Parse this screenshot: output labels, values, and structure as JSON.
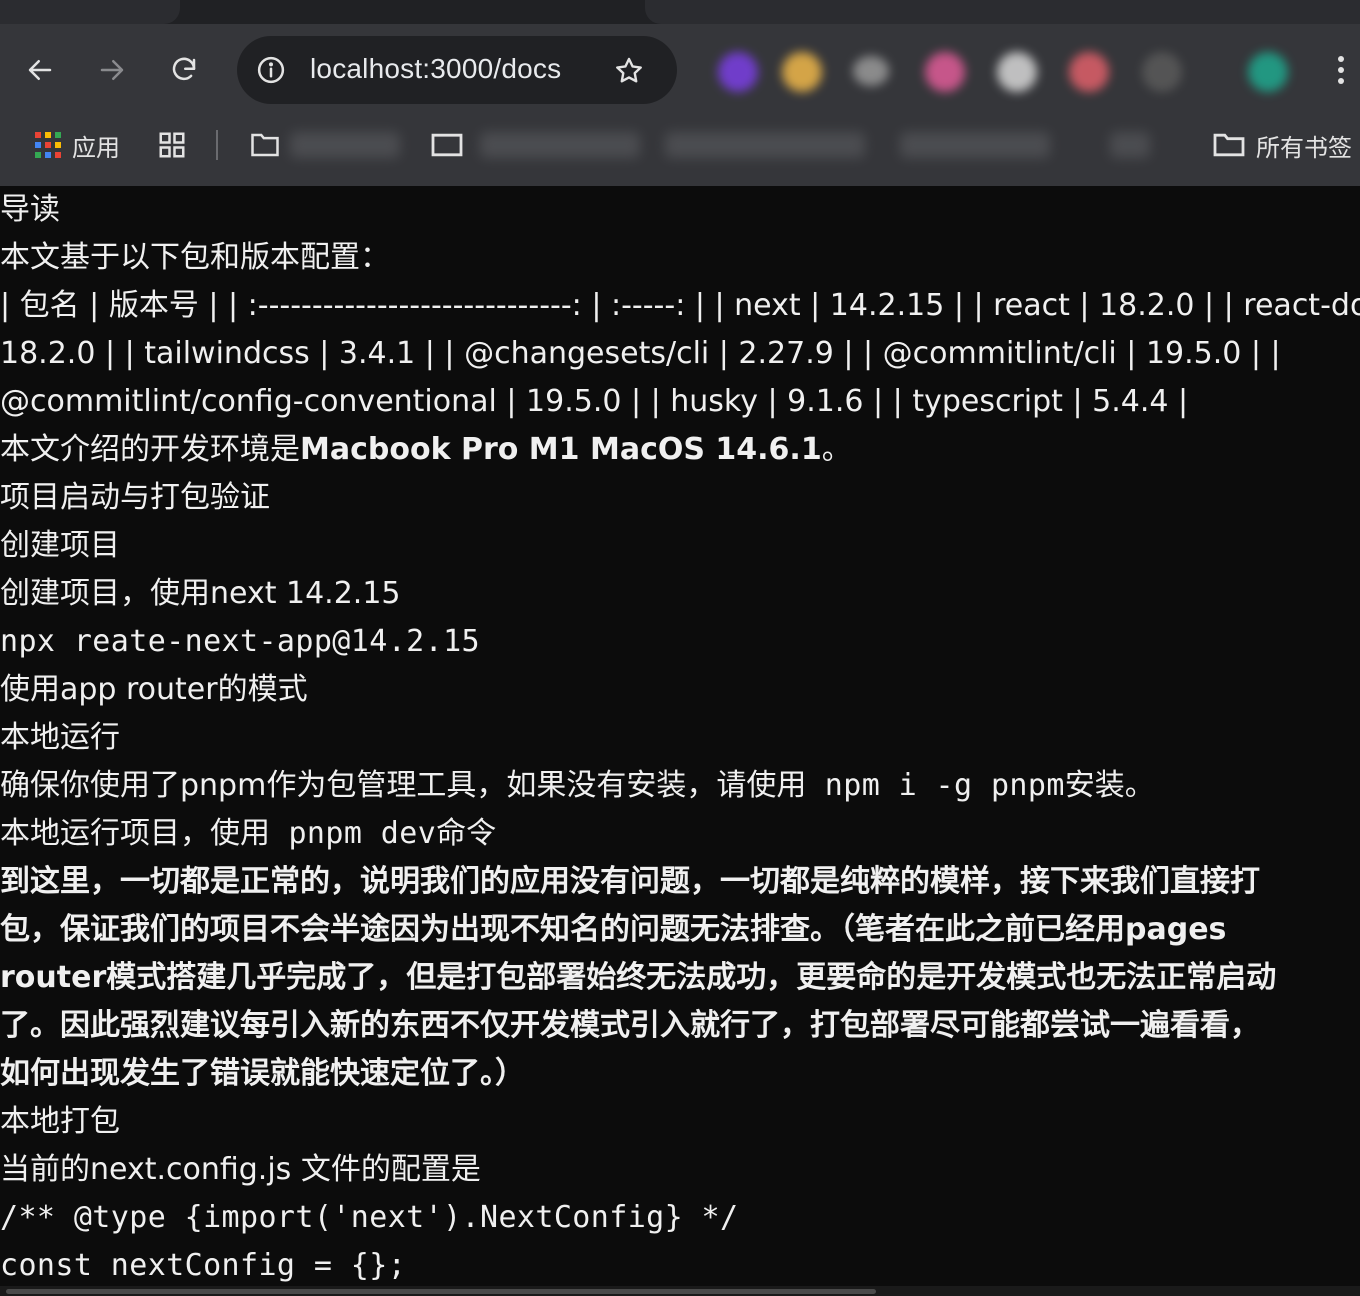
{
  "browser": {
    "url": "localhost:3000/docs",
    "bookmarks": {
      "apps_label": "应用",
      "all_bookmarks_label": "所有书签"
    },
    "extension_icon_colors": [
      "#7b3fe4",
      "#f0b84a",
      "#9a9a9a",
      "#e05c98",
      "#d8d8d8",
      "#e0606a",
      "#5a5a5a",
      "#1fa88e"
    ]
  },
  "doc": {
    "l1": "导读",
    "l2": "本文基于以下包和版本配置：",
    "l3": "| 包名 | 版本号 | | :-----------------------------: | :-----: | | next | 14.2.15 | | react | 18.2.0 | | react-dom |",
    "l4": "18.2.0 | | tailwindcss | 3.4.1 | | @changesets/cli | 2.27.9 | | @commitlint/cli | 19.5.0 | |",
    "l5": "@commitlint/config-conventional | 19.5.0 | | husky | 9.1.6 | | typescript | 5.4.4 |",
    "l6_prefix": "本文介绍的开发环境是",
    "l6_bold": "Macbook Pro M1 MacOS 14.6.1",
    "l6_suffix": "。",
    "l7": "项目启动与打包验证",
    "l8": "创建项目",
    "l9": "创建项目，使用next 14.2.15",
    "l10": "npx reate-next-app@14.2.15",
    "l11": "使用app router的模式",
    "l12": "本地运行",
    "l13_prefix": "确保你使用了pnpm作为包管理工具，如果没有安装，请使用",
    "l13_code": " npm i -g pnpm",
    "l13_suffix": "安装。",
    "l14_prefix": "本地运行项目，使用",
    "l14_code": " pnpm dev",
    "l14_suffix": "命令",
    "bold_para_1": "到这里，一切都是正常的，说明我们的应用没有问题，一切都是纯粹的模样，接下来我们直接打",
    "bold_para_2": "包，保证我们的项目不会半途因为出现不知名的问题无法排查。（笔者在此之前已经用pages",
    "bold_para_3": "router模式搭建几乎完成了，但是打包部署始终无法成功，更要命的是开发模式也无法正常启动",
    "bold_para_4": "了。因此强烈建议每引入新的东西不仅开发模式引入就行了，打包部署尽可能都尝试一遍看看，",
    "bold_para_5": "如何出现发生了错误就能快速定位了。）",
    "l16": "本地打包",
    "l17": "当前的next.config.js 文件的配置是",
    "l18": "/** @type {import('next').NextConfig} */",
    "l19": "const nextConfig = {};"
  }
}
